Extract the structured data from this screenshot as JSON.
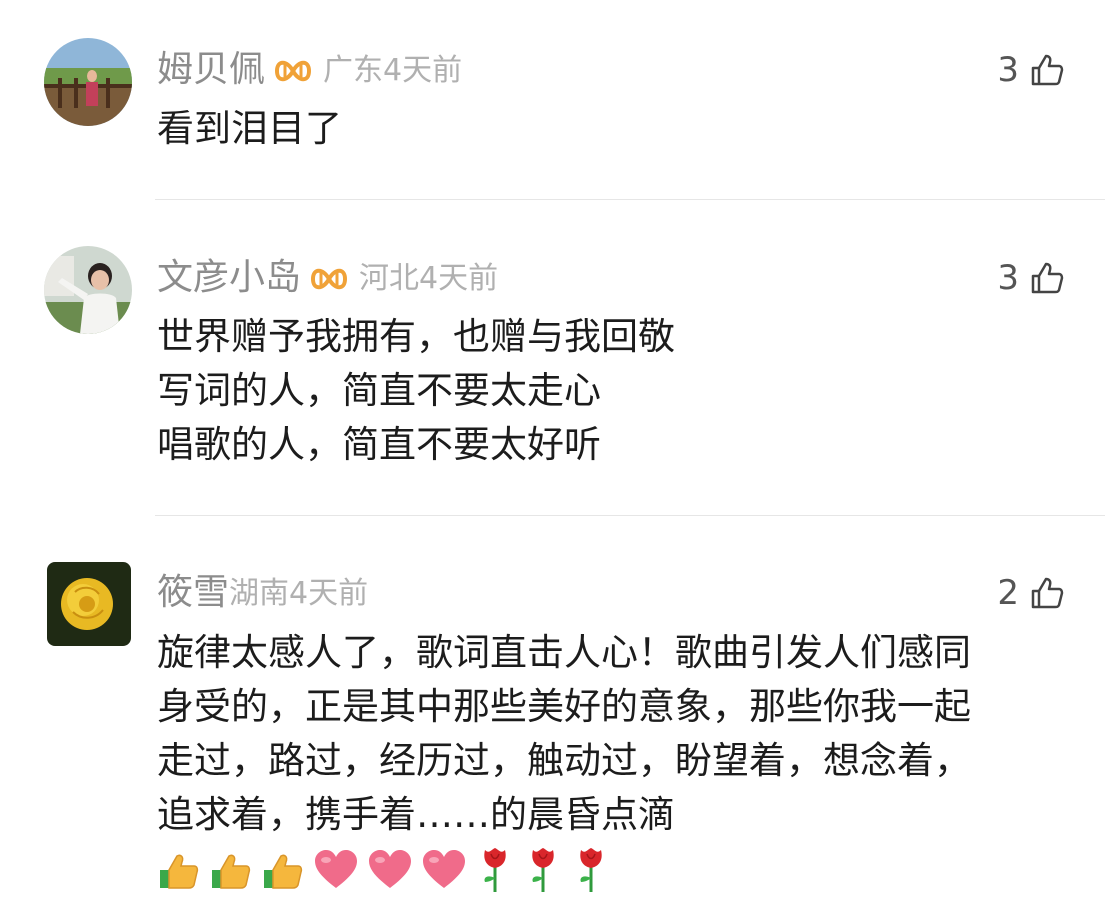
{
  "comments": [
    {
      "user": "姆贝佩",
      "region": "广东",
      "time": "4天前",
      "likes": "3",
      "lines": [
        "看到泪目了"
      ]
    },
    {
      "user": "文彦小岛",
      "region": "河北",
      "time": "4天前",
      "likes": "3",
      "lines": [
        "世界赠予我拥有，也赠与我回敬",
        "写词的人，简直不要太走心",
        "唱歌的人，简直不要太好听"
      ]
    },
    {
      "user": "筱雪",
      "region": "湖南",
      "time": "4天前",
      "likes": "2",
      "lines": [
        "旋律太感人了，歌词直击人心！歌曲引发人们感同",
        "身受的，正是其中那些美好的意象，那些你我一起",
        "走过，路过，经历过，触动过，盼望着，想念着，",
        "追求着，携手着……的晨昏点滴"
      ],
      "emojis": [
        "thumbs-up-icon",
        "thumbs-up-icon",
        "thumbs-up-icon",
        "heart-icon",
        "heart-icon",
        "heart-icon",
        "rose-icon",
        "rose-icon",
        "rose-icon"
      ]
    }
  ],
  "colors": {
    "badge": "#f0a238",
    "name": "#8c8c8c",
    "meta": "#b0b0b0",
    "text": "#1c1c1c"
  }
}
